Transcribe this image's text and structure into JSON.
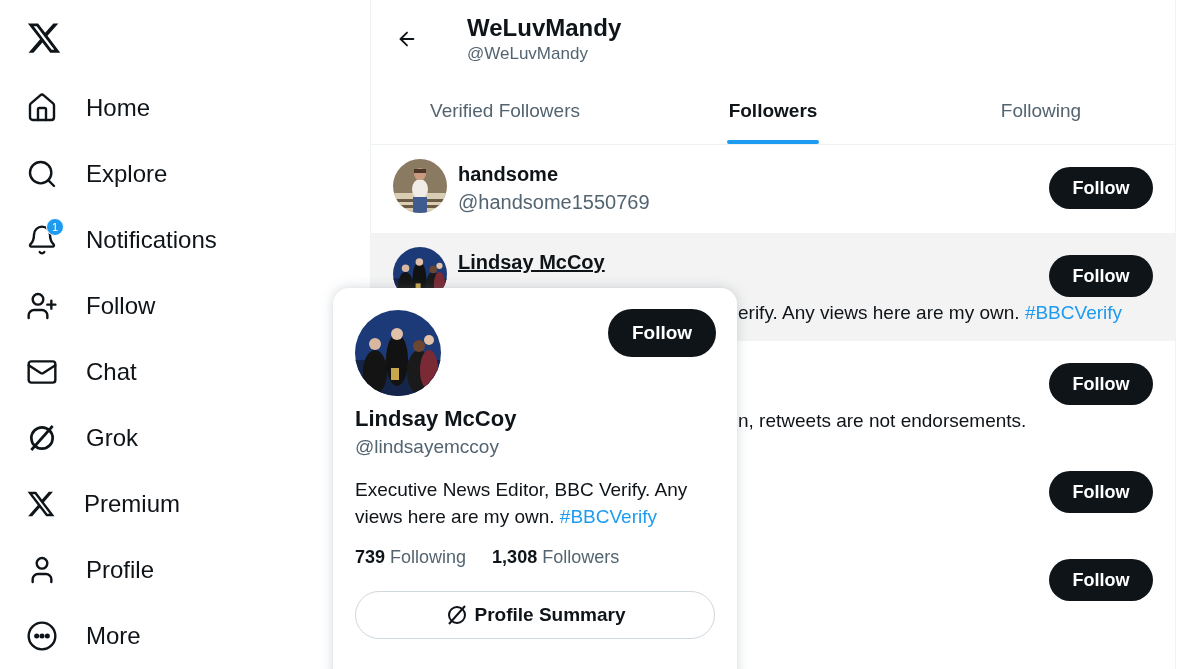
{
  "sidebar": {
    "items": [
      {
        "kind": "home",
        "label": "Home"
      },
      {
        "kind": "explore",
        "label": "Explore"
      },
      {
        "kind": "notifications",
        "label": "Notifications",
        "badge": "1"
      },
      {
        "kind": "follow",
        "label": "Follow"
      },
      {
        "kind": "chat",
        "label": "Chat"
      },
      {
        "kind": "grok",
        "label": "Grok"
      },
      {
        "kind": "premium",
        "label": "Premium"
      },
      {
        "kind": "profile",
        "label": "Profile"
      },
      {
        "kind": "more",
        "label": "More"
      }
    ]
  },
  "header": {
    "title": "WeLuvMandy",
    "handle": "@WeLuvMandy"
  },
  "tabs": [
    {
      "label": "Verified Followers",
      "selected": false
    },
    {
      "label": "Followers",
      "selected": true
    },
    {
      "label": "Following",
      "selected": false
    }
  ],
  "followers": [
    {
      "name": "handsome",
      "handle": "@handsome1550769",
      "hovered": false,
      "button": "Follow"
    },
    {
      "name": "Lindsay McCoy",
      "hovered": true,
      "bio": "erify. Any views here are my own. ",
      "bio_link": "#BBCVerify",
      "button": "Follow"
    },
    {
      "hovered": false,
      "bio": "n, retweets are not endorsements.",
      "button": "Follow"
    },
    {
      "hovered": false,
      "button": "Follow"
    },
    {
      "hovered": false,
      "button": "Follow"
    }
  ],
  "hover_card": {
    "name": "Lindsay McCoy",
    "handle": "@lindsayemccoy",
    "button": "Follow",
    "bio": "Executive News Editor, BBC Verify. Any views here are my own. ",
    "bio_link": "#BBCVerify",
    "stats": [
      {
        "count": "739",
        "label": "Following"
      },
      {
        "count": "1,308",
        "label": "Followers"
      }
    ],
    "summary_button": "Profile Summary"
  }
}
